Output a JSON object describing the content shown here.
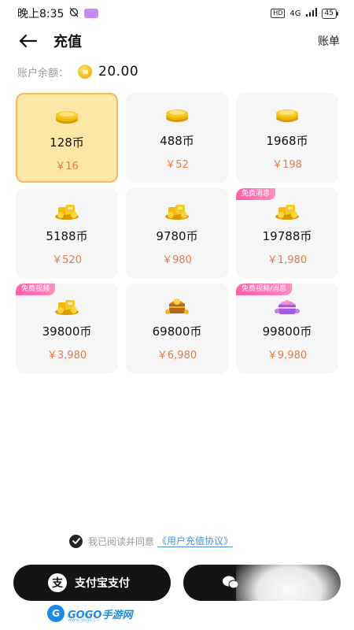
{
  "status_bar": {
    "time": "晚上8:35",
    "hd": "HD",
    "network": "4G",
    "battery": "45"
  },
  "header": {
    "title": "充值",
    "bill_label": "账单"
  },
  "balance": {
    "label": "账户余额：",
    "value": "20.00"
  },
  "packages": [
    {
      "coins": "128币",
      "price": "￥16",
      "tag": "",
      "icon": "coin-stack-icon",
      "selected": true
    },
    {
      "coins": "488币",
      "price": "￥52",
      "tag": "",
      "icon": "coin-stack-icon",
      "selected": false
    },
    {
      "coins": "1968币",
      "price": "￥198",
      "tag": "",
      "icon": "coin-stack-icon",
      "selected": false
    },
    {
      "coins": "5188币",
      "price": "￥520",
      "tag": "",
      "icon": "gold-pile-icon",
      "selected": false
    },
    {
      "coins": "9780币",
      "price": "￥980",
      "tag": "",
      "icon": "gold-pile-icon",
      "selected": false
    },
    {
      "coins": "19788币",
      "price": "￥1,980",
      "tag": "免费消息",
      "icon": "gold-pile-icon",
      "selected": false
    },
    {
      "coins": "39800币",
      "price": "￥3,980",
      "tag": "免费视频",
      "icon": "gold-pile-icon",
      "selected": false
    },
    {
      "coins": "69800币",
      "price": "￥6,980",
      "tag": "",
      "icon": "treasure-chest-icon",
      "selected": false
    },
    {
      "coins": "99800币",
      "price": "￥9,980",
      "tag": "免费视频/消息",
      "icon": "purple-chest-icon",
      "selected": false
    }
  ],
  "agreement": {
    "text": "我已阅读并同意",
    "link": "《用户充值协议》"
  },
  "payment": {
    "alipay_label": "支付宝支付",
    "alipay_icon_char": "支"
  },
  "watermark": {
    "brand": "GOGO手游网",
    "sub": "www.gogo.cn"
  },
  "colors": {
    "accent_price": "#e07c4a",
    "selected_bg": "#fde6a6",
    "selected_border": "#f3b95a",
    "tag_pink": "#ff5fa8",
    "button_dark": "#141414",
    "link_blue": "#4a90e2"
  }
}
